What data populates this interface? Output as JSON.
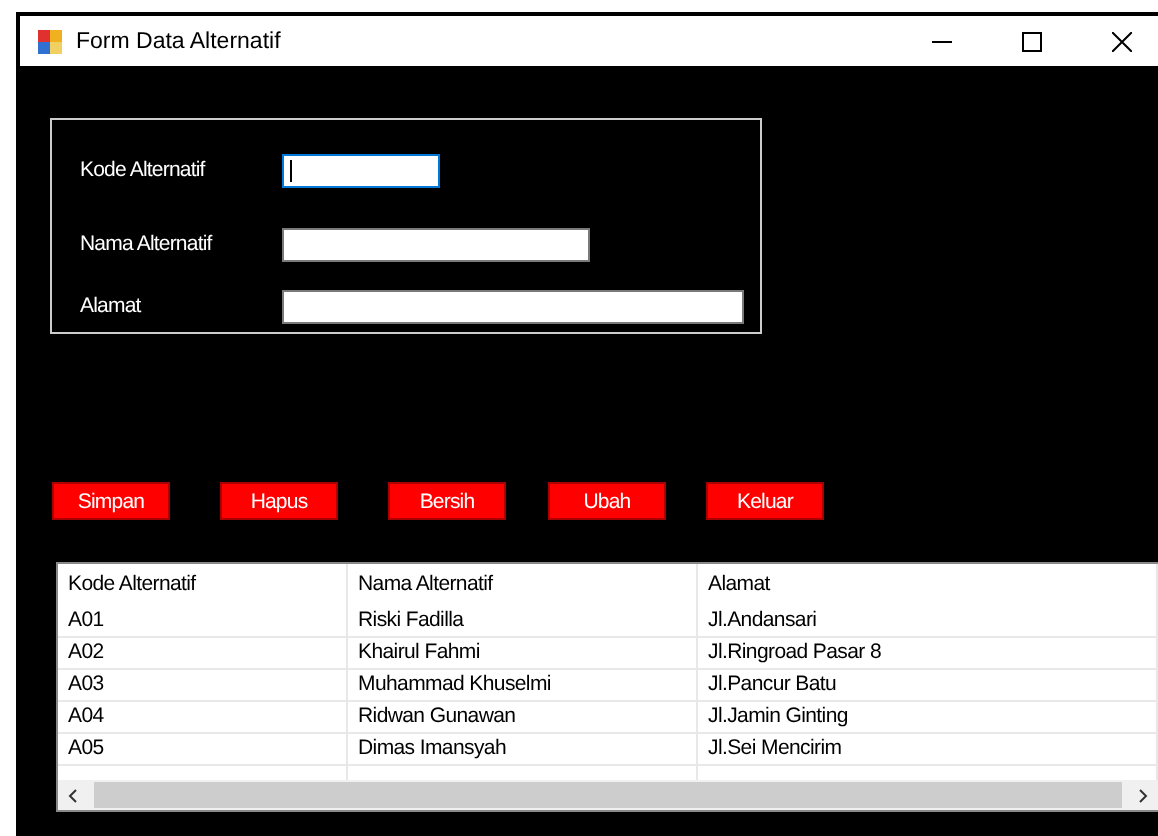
{
  "window": {
    "title": "Form Data Alternatif"
  },
  "fields": [
    {
      "label": "Kode Alternatif",
      "focused": true
    },
    {
      "label": "Nama Alternatif",
      "focused": false
    },
    {
      "label": "Alamat",
      "focused": false
    }
  ],
  "buttons": [
    "Simpan",
    "Hapus",
    "Bersih",
    "Ubah",
    "Keluar"
  ],
  "table": {
    "columns": [
      "Kode Alternatif",
      "Nama Alternatif",
      "Alamat"
    ],
    "rows": [
      [
        "A01",
        "Riski Fadilla",
        "Jl.Andansari"
      ],
      [
        "A02",
        "Khairul Fahmi",
        "Jl.Ringroad Pasar 8"
      ],
      [
        "A03",
        "Muhammad Khuselmi",
        "Jl.Pancur Batu"
      ],
      [
        "A04",
        "Ridwan Gunawan",
        "Jl.Jamin Ginting"
      ],
      [
        "A05",
        "Dimas Imansyah",
        "Jl.Sei Mencirim"
      ]
    ]
  }
}
